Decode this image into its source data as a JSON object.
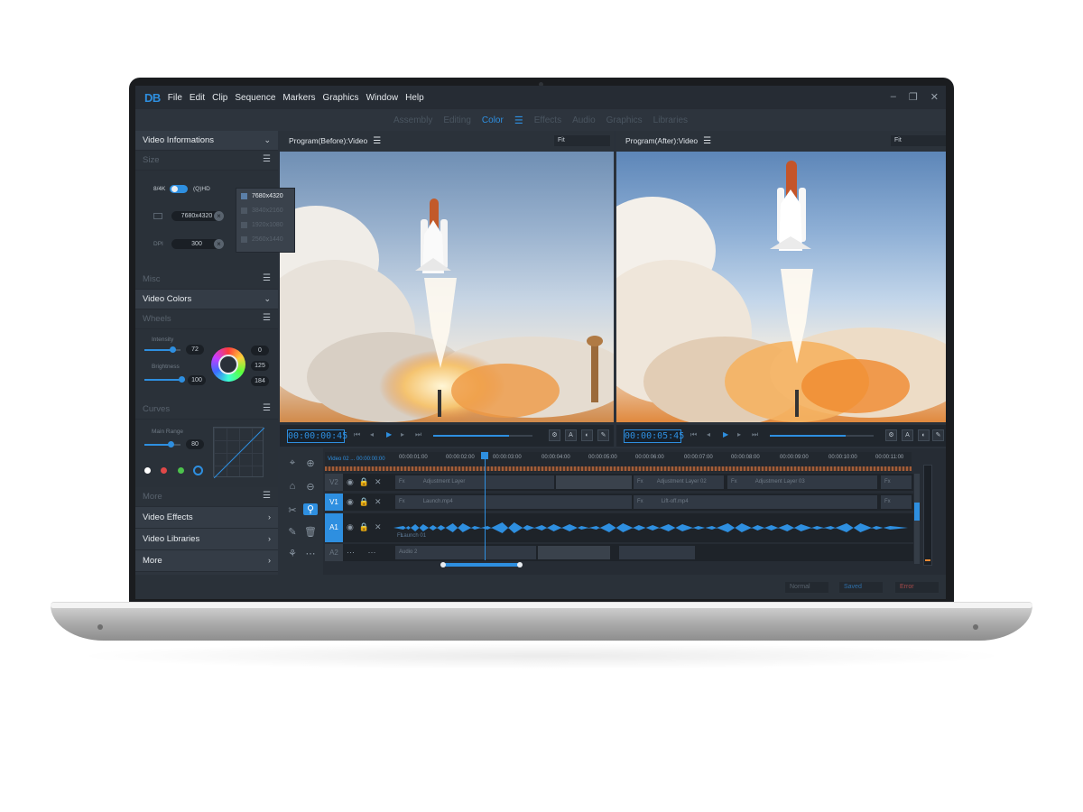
{
  "app": {
    "logo": "DB",
    "menu": [
      "File",
      "Edit",
      "Clip",
      "Sequence",
      "Markers",
      "Graphics",
      "Window",
      "Help"
    ],
    "window_controls": [
      "–",
      "❐",
      "✕"
    ]
  },
  "workspace_tabs": [
    {
      "label": "Assembly",
      "active": false
    },
    {
      "label": "Editing",
      "active": false
    },
    {
      "label": "Color",
      "active": true
    },
    {
      "label": "Effects",
      "active": false
    },
    {
      "label": "Audio",
      "active": false
    },
    {
      "label": "Graphics",
      "active": false
    },
    {
      "label": "Libraries",
      "active": false
    }
  ],
  "left_panel": {
    "video_info_title": "Video Informations",
    "size_section": "Size",
    "toggle_left": "8/4K",
    "toggle_right": "(Q)HD",
    "resolution_value": "7680x4320",
    "dpi_value": "300",
    "dpi_label": "DPI",
    "resolution_options": [
      "7680x4320",
      "3840x2160",
      "1920x1080",
      "2560x1440"
    ],
    "selected_resolution": "7680x4320",
    "misc_section": "Misc",
    "video_colors_title": "Video Colors",
    "wheels_section": "Wheels",
    "wheel_values": {
      "slider_a": "72",
      "slider_b": "100",
      "r": "0",
      "g": "125",
      "b": "184"
    },
    "wheel_labels": {
      "a": "Intensity",
      "b": "Brightness"
    },
    "curves_section": "Curves",
    "curves_label": "Main Range",
    "curves_value": "80",
    "more_section": "More",
    "nav_items": [
      "Video Effects",
      "Video Libraries",
      "More"
    ],
    "dot_colors": [
      "#ffffff",
      "#e04848",
      "#4cc24c",
      "#2e8fe0"
    ]
  },
  "panes": [
    {
      "title": "Program(Before):Video",
      "fit": "Fit",
      "timecode": "00:00:00:45"
    },
    {
      "title": "Program(After):Video",
      "fit": "Fit",
      "timecode": "00:00:05:45"
    }
  ],
  "timeline": {
    "sequence_name": "Video 02 ... 00:00:00:00",
    "ticks": [
      "00:00:01:00",
      "00:00:02:00",
      "00:00:03:00",
      "00:00:04:00",
      "00:00:05:00",
      "00:00:06:00",
      "00:00:07:00",
      "00:00:08:00",
      "00:00:09:00",
      "00:00:10:00",
      "00:00:11:00"
    ],
    "tracks": [
      "V2",
      "V1",
      "A1",
      "A2"
    ],
    "clip_labels": {
      "fx": "Fx",
      "v2_a": "Adjustment Layer",
      "v2_b": "Adjustment Layer 02",
      "v2_c": "Adjustment Layer 03",
      "v1_a": "Launch.mp4",
      "v1_b": "Lift-off.mp4",
      "a1_a": "Launch 01",
      "a2_a": "Audio 2"
    }
  },
  "status": {
    "normal": "Normal",
    "saved": "Saved",
    "error": "Error"
  },
  "colors": {
    "accent": "#2e8fe0",
    "panel": "#2e353e",
    "bg": "#2a313a"
  }
}
